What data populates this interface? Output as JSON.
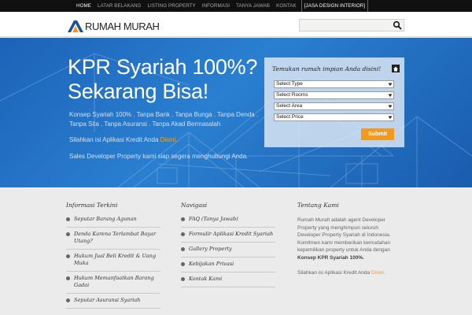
{
  "nav": {
    "items": [
      "HOME",
      "LATAR BELAKANG",
      "LISTING PROPERTY",
      "INFORMASI",
      "TANYA JAWAB",
      "KONTAK",
      "[JASA DESIGN INTERIOR]"
    ]
  },
  "header": {
    "logo_text": "RUMAH MURAH",
    "search_placeholder": ""
  },
  "hero": {
    "title_line1": "KPR Syariah 100%?",
    "title_line2": "Sekarang Bisa!",
    "tagline_line1": "Konsep Syariah 100% . Tanpa Bank . Tanpa Bunga . Tanpa Denda .",
    "tagline_line2": "Tanpa Sita . Tanpa Asuransi . Tanpa Akad Bermasalah",
    "apply_text": "Silahkan isi Aplikasi Kredit Anda ",
    "apply_link": "Disini.",
    "sales_text": "Sales Developer Property kami siap segera menghubungi Anda."
  },
  "search_panel": {
    "title": "Temukan rumah impian Anda disini!",
    "selects": [
      "Select Type",
      "Select Rooms",
      "Select Area",
      "Select Price"
    ],
    "submit_label": "Submit"
  },
  "footer": {
    "col1": {
      "title": "Informasi Terkini",
      "items": [
        "Seputar Barang Agunan",
        "Denda Karena Terlambat Bayar Utang?",
        "Hukum Jual Beli Kredit & Uang Muka",
        "Hukum Memanfaatkan Barang Gadai",
        "Seputar Asuransi Syariah"
      ]
    },
    "col2": {
      "title": "Navigasi",
      "items": [
        "FAQ (Tanya Jawab)",
        "Formulir Aplikasi Kredit Syariah",
        "Gallery Property",
        "Kebijakan Privasi",
        "Kontak Kami"
      ]
    },
    "col3": {
      "title": "Tentang Kami",
      "about_text": "Rumah Murah adalah agent Developer Property yang menghimpun seluruh Developer Property Syariah di Indonesia. Komitmen kami memberikan kemudahan kepemilikan property untuk Anda dengan ",
      "about_bold": "Konsep KPR Syariah 100%.",
      "apply_text": "Silahkan isi Aplikasi Kredit Anda ",
      "apply_link": "Disini."
    }
  },
  "colors": {
    "accent": "#f29a1d",
    "hero_blue": "#2a7fd0",
    "nav_bg": "#101010"
  }
}
